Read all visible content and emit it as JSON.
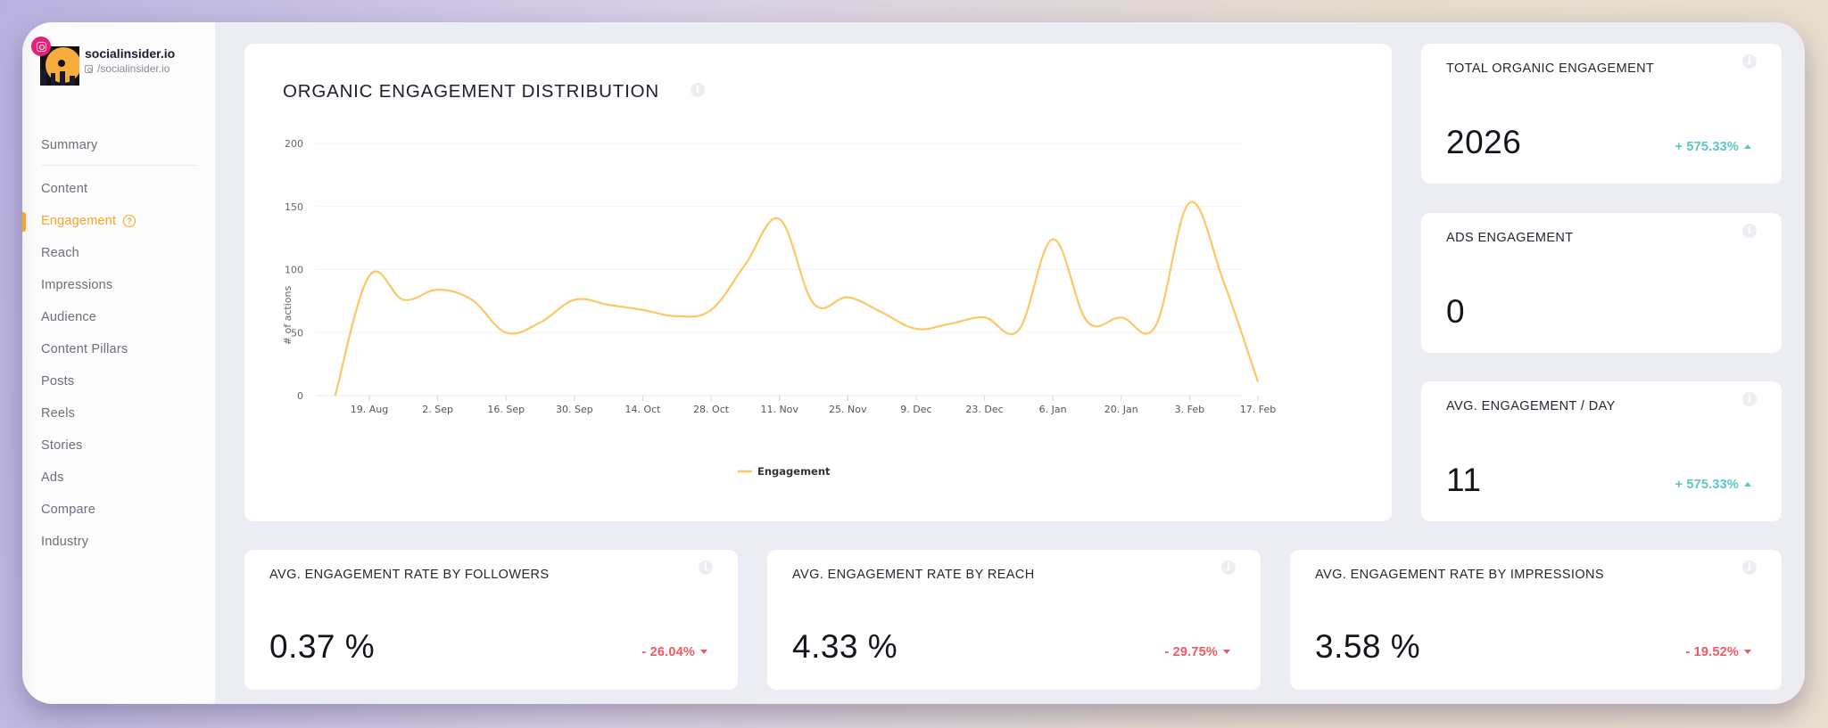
{
  "profile": {
    "name": "socialinsider.io",
    "handle": "/socialinsider.io",
    "network": "instagram"
  },
  "sidebar": {
    "items": [
      {
        "label": "Summary",
        "active": false
      },
      {
        "label": "Content",
        "active": false
      },
      {
        "label": "Engagement",
        "active": true,
        "help": "?"
      },
      {
        "label": "Reach",
        "active": false
      },
      {
        "label": "Impressions",
        "active": false
      },
      {
        "label": "Audience",
        "active": false
      },
      {
        "label": "Content Pillars",
        "active": false
      },
      {
        "label": "Posts",
        "active": false
      },
      {
        "label": "Reels",
        "active": false
      },
      {
        "label": "Stories",
        "active": false
      },
      {
        "label": "Ads",
        "active": false
      },
      {
        "label": "Compare",
        "active": false
      },
      {
        "label": "Industry",
        "active": false
      }
    ]
  },
  "colors": {
    "accent": "#f5a623",
    "line": "#fdc765",
    "positive": "#5cc6c6",
    "negative": "#ec5b63",
    "instagram": "#ec1e79"
  },
  "chart_card": {
    "title": "ORGANIC ENGAGEMENT DISTRIBUTION",
    "info": "i"
  },
  "chart_data": {
    "type": "line",
    "title": "ORGANIC ENGAGEMENT DISTRIBUTION",
    "xlabel": "",
    "ylabel": "# of actions",
    "ylim": [
      0,
      200
    ],
    "yticks": [
      0,
      50,
      100,
      150,
      200
    ],
    "grid": true,
    "legend": "bottom-center",
    "xticks": [
      "19. Aug",
      "2. Sep",
      "16. Sep",
      "30. Sep",
      "14. Oct",
      "28. Oct",
      "11. Nov",
      "25. Nov",
      "9. Dec",
      "23. Dec",
      "6. Jan",
      "20. Jan",
      "3. Feb",
      "17. Feb"
    ],
    "x": [
      "12 Aug",
      "19 Aug",
      "26 Aug",
      "2 Sep",
      "9 Sep",
      "16 Sep",
      "23 Sep",
      "30 Sep",
      "7 Oct",
      "14 Oct",
      "21 Oct",
      "28 Oct",
      "4 Nov",
      "11 Nov",
      "18 Nov",
      "25 Nov",
      "2 Dec",
      "9 Dec",
      "16 Dec",
      "23 Dec",
      "30 Dec",
      "6 Jan",
      "13 Jan",
      "20 Jan",
      "27 Jan",
      "3 Feb",
      "10 Feb",
      "17 Feb"
    ],
    "series": [
      {
        "name": "Engagement",
        "color": "#fdc765",
        "values": [
          0,
          95,
          76,
          84,
          76,
          50,
          58,
          76,
          72,
          68,
          63,
          68,
          104,
          140,
          73,
          78,
          66,
          53,
          57,
          62,
          52,
          124,
          59,
          62,
          55,
          153,
          90,
          11
        ]
      }
    ]
  },
  "stats_right": [
    {
      "title": "TOTAL ORGANIC ENGAGEMENT",
      "value": "2026",
      "change": "+ 575.33%",
      "direction": "up"
    },
    {
      "title": "ADS ENGAGEMENT",
      "value": "0",
      "change": "",
      "direction": "none"
    },
    {
      "title": "AVG. ENGAGEMENT / DAY",
      "value": "11",
      "change": "+ 575.33%",
      "direction": "up"
    }
  ],
  "stats_bottom": [
    {
      "title": "AVG. ENGAGEMENT RATE BY FOLLOWERS",
      "value": "0.37 %",
      "change": "- 26.04%",
      "direction": "down"
    },
    {
      "title": "AVG. ENGAGEMENT RATE BY REACH",
      "value": "4.33 %",
      "change": "- 29.75%",
      "direction": "down"
    },
    {
      "title": "AVG. ENGAGEMENT RATE BY IMPRESSIONS",
      "value": "3.58 %",
      "change": "- 19.52%",
      "direction": "down"
    }
  ]
}
